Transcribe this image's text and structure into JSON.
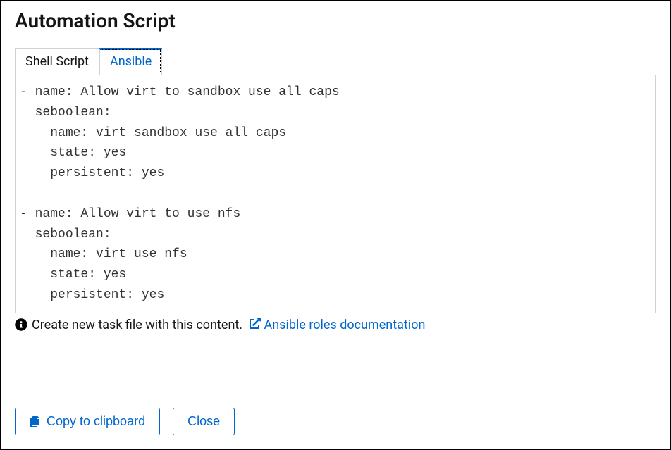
{
  "title": "Automation Script",
  "tabs": {
    "shell": "Shell Script",
    "ansible": "Ansible"
  },
  "code": "- name: Allow virt to sandbox use all caps\n  seboolean:\n    name: virt_sandbox_use_all_caps\n    state: yes\n    persistent: yes\n\n- name: Allow virt to use nfs\n  seboolean:\n    name: virt_use_nfs\n    state: yes\n    persistent: yes",
  "hint": {
    "text": "Create new task file with this content.",
    "link": "Ansible roles documentation"
  },
  "buttons": {
    "copy": "Copy to clipboard",
    "close": "Close"
  }
}
